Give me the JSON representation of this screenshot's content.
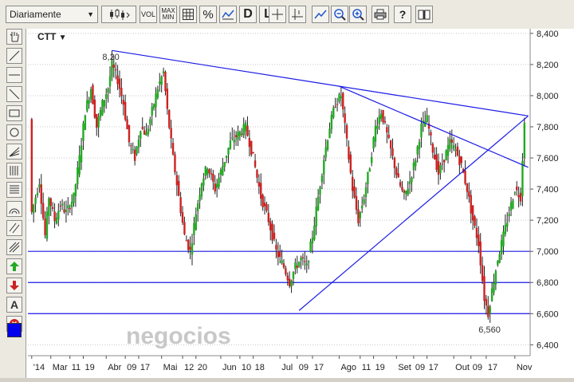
{
  "toolbar": {
    "period_select": "Diariamente",
    "volume_label": "VOL",
    "maxmin_label_top": "MAX",
    "maxmin_label_bottom": "MIN",
    "percent_label": "%",
    "line_label": "L",
    "d_label": "D",
    "question_label": "?",
    "icons": [
      "candlestick-chart-icon",
      "grid-icon",
      "line-chart-icon",
      "crosshair-icon",
      "cursor-crosshair-icon",
      "trend-icon",
      "zoom-out-icon",
      "zoom-in-icon",
      "print-icon",
      "help-icon",
      "book-icon"
    ]
  },
  "leftbar": {
    "icons": [
      "hand-icon",
      "line-tool-icon",
      "horizontal-line-icon",
      "diagonal-line-icon",
      "rectangle-icon",
      "circle-icon",
      "fan-icon",
      "fibonacci-icon",
      "grid-lines-icon",
      "arc-icon",
      "channel-icon",
      "parallel-icon",
      "up-arrow-icon",
      "down-arrow-icon",
      "text-icon",
      "delete-icon",
      "color-picker-icon"
    ],
    "text_tool_label": "A"
  },
  "chart": {
    "symbol": "CTT",
    "symbol_caret": "▼",
    "watermark": "negocios",
    "high_label": "8,20",
    "low_label": "6,560",
    "colors": {
      "up": "#22aa22",
      "down": "#cc2222",
      "trendline": "#1a1ae6",
      "grid": "#c8c8c8"
    }
  },
  "chart_data": {
    "type": "candlestick",
    "y_ticks": [
      "8,400",
      "8,200",
      "8,000",
      "7,800",
      "7,600",
      "7,400",
      "7,200",
      "7,000",
      "6,800",
      "6,600",
      "6,400"
    ],
    "ylim": [
      6.33,
      8.43
    ],
    "x_ticks": [
      {
        "label": "'14",
        "t": 0
      },
      {
        "label": "Mar",
        "t": 10
      },
      {
        "label": "11",
        "t": 20
      },
      {
        "label": "19",
        "t": 27
      },
      {
        "label": "Abr",
        "t": 39
      },
      {
        "label": "09",
        "t": 49
      },
      {
        "label": "17",
        "t": 56
      },
      {
        "label": "Mai",
        "t": 68
      },
      {
        "label": "12",
        "t": 79
      },
      {
        "label": "20",
        "t": 86
      },
      {
        "label": "Jun",
        "t": 99
      },
      {
        "label": "10",
        "t": 109
      },
      {
        "label": "18",
        "t": 116
      },
      {
        "label": "Jul",
        "t": 130
      },
      {
        "label": "09",
        "t": 139
      },
      {
        "label": "17",
        "t": 147
      },
      {
        "label": "Ago",
        "t": 161
      },
      {
        "label": "11",
        "t": 172
      },
      {
        "label": "19",
        "t": 179
      },
      {
        "label": "Set",
        "t": 191
      },
      {
        "label": "09",
        "t": 200
      },
      {
        "label": "17",
        "t": 207
      },
      {
        "label": "Out",
        "t": 221
      },
      {
        "label": "09",
        "t": 230
      },
      {
        "label": "17",
        "t": 238
      },
      {
        "label": "Nov",
        "t": 253
      }
    ],
    "t_range": [
      -2,
      261
    ],
    "close_path": [
      [
        0,
        7.25
      ],
      [
        4,
        7.45
      ],
      [
        7,
        7.1
      ],
      [
        9,
        7.35
      ],
      [
        12,
        7.2
      ],
      [
        15,
        7.3
      ],
      [
        18,
        7.25
      ],
      [
        22,
        7.35
      ],
      [
        25,
        7.6
      ],
      [
        28,
        7.9
      ],
      [
        31,
        8.05
      ],
      [
        34,
        7.8
      ],
      [
        37,
        7.95
      ],
      [
        40,
        8.05
      ],
      [
        42,
        8.2
      ],
      [
        45,
        8.1
      ],
      [
        48,
        7.95
      ],
      [
        51,
        7.7
      ],
      [
        54,
        7.6
      ],
      [
        57,
        7.8
      ],
      [
        60,
        7.75
      ],
      [
        63,
        7.9
      ],
      [
        66,
        8.05
      ],
      [
        69,
        8.15
      ],
      [
        71,
        7.9
      ],
      [
        74,
        7.6
      ],
      [
        77,
        7.35
      ],
      [
        80,
        7.1
      ],
      [
        83,
        7.0
      ],
      [
        86,
        7.25
      ],
      [
        89,
        7.45
      ],
      [
        92,
        7.55
      ],
      [
        96,
        7.4
      ],
      [
        100,
        7.55
      ],
      [
        104,
        7.7
      ],
      [
        108,
        7.75
      ],
      [
        112,
        7.8
      ],
      [
        116,
        7.6
      ],
      [
        120,
        7.35
      ],
      [
        124,
        7.2
      ],
      [
        128,
        7.0
      ],
      [
        132,
        6.9
      ],
      [
        135,
        6.8
      ],
      [
        138,
        6.9
      ],
      [
        141,
        6.95
      ],
      [
        144,
        6.9
      ],
      [
        147,
        7.1
      ],
      [
        150,
        7.35
      ],
      [
        153,
        7.6
      ],
      [
        156,
        7.8
      ],
      [
        159,
        7.95
      ],
      [
        162,
        8.0
      ],
      [
        165,
        7.7
      ],
      [
        168,
        7.4
      ],
      [
        171,
        7.2
      ],
      [
        174,
        7.35
      ],
      [
        177,
        7.55
      ],
      [
        180,
        7.8
      ],
      [
        183,
        7.9
      ],
      [
        186,
        7.75
      ],
      [
        189,
        7.6
      ],
      [
        192,
        7.45
      ],
      [
        195,
        7.35
      ],
      [
        198,
        7.45
      ],
      [
        201,
        7.6
      ],
      [
        204,
        7.8
      ],
      [
        207,
        7.85
      ],
      [
        210,
        7.65
      ],
      [
        213,
        7.5
      ],
      [
        216,
        7.6
      ],
      [
        219,
        7.7
      ],
      [
        222,
        7.65
      ],
      [
        225,
        7.55
      ],
      [
        228,
        7.4
      ],
      [
        231,
        7.2
      ],
      [
        234,
        7.05
      ],
      [
        237,
        6.7
      ],
      [
        239,
        6.6
      ],
      [
        241,
        6.75
      ],
      [
        244,
        6.95
      ],
      [
        247,
        7.1
      ],
      [
        250,
        7.25
      ],
      [
        253,
        7.4
      ],
      [
        256,
        7.35
      ],
      [
        258,
        7.85
      ]
    ],
    "annotations": [
      {
        "label": "8,20",
        "t": 42,
        "value": 8.2
      },
      {
        "label": "6,560",
        "t": 239,
        "value": 6.56
      }
    ],
    "horizontal_levels": [
      7.0,
      6.8,
      6.6
    ],
    "trendlines": [
      {
        "from": [
          42,
          8.29
        ],
        "to": [
          260,
          7.87
        ]
      },
      {
        "from": [
          161,
          8.06
        ],
        "to": [
          260,
          7.54
        ]
      },
      {
        "from": [
          140,
          6.62
        ],
        "to": [
          260,
          7.87
        ]
      }
    ]
  }
}
